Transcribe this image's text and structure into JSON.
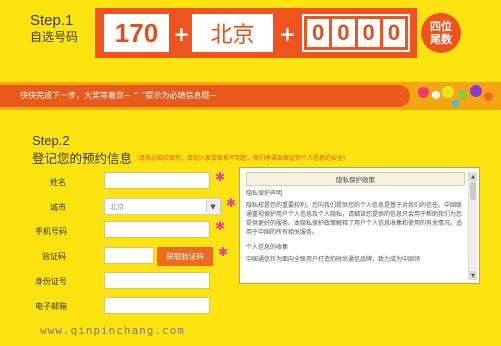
{
  "step1": {
    "title_en": "Step.1",
    "title_cn": "自选号码",
    "prefix": "170",
    "plus1": "+",
    "city": "北京",
    "plus2": "+",
    "digits": [
      "0",
      "0",
      "0",
      "0"
    ],
    "badge_line1": "四位",
    "badge_line2": "尾数"
  },
  "hint": {
    "text_before": "快快完成下一步，大奖等着您~  “",
    "star": "*",
    "text_after": "”提示为必填信息哦~"
  },
  "step2": {
    "title_en": "Step.2",
    "title_cn": "登记您的预约信息",
    "note": "（请务必如实填写，否则人家会联系不到您，我们承诺会保证你个人信息的安全）"
  },
  "form": {
    "name_label": "姓名",
    "city_label": "城市",
    "city_value": "北京",
    "phone_label": "手机号码",
    "code_label": "验证码",
    "code_button": "获取验证码",
    "id_label": "身份证号",
    "email_label": "电子邮箱",
    "required_mark": "✱"
  },
  "privacy": {
    "heading": "隐私保护政策",
    "section1_title": "隐私保护声明",
    "section1_body": "隐私权是您的重要权利。您向我们提供您的个人信息是基于对我们的信任。中国联通重视保护用户个人信息及个人隐私，请细读您提供的信息只会用于帮助我们为您提供更好的服务。本隐私保护政策解释了用户个人信息收集和使用的有关情况。适用于中国的所有相关服务。",
    "section2_title": "个人信息的收集",
    "section2_body": "中国通信作为面向全联用户打造的时尚通信品牌，致力成为中国领"
  },
  "watermark": "www.qinpinchang.com",
  "colors": {
    "background": "#fde30f",
    "accent_orange": "#f0531e",
    "hint_bar": "#f5a513",
    "required": "#e83aa8"
  }
}
